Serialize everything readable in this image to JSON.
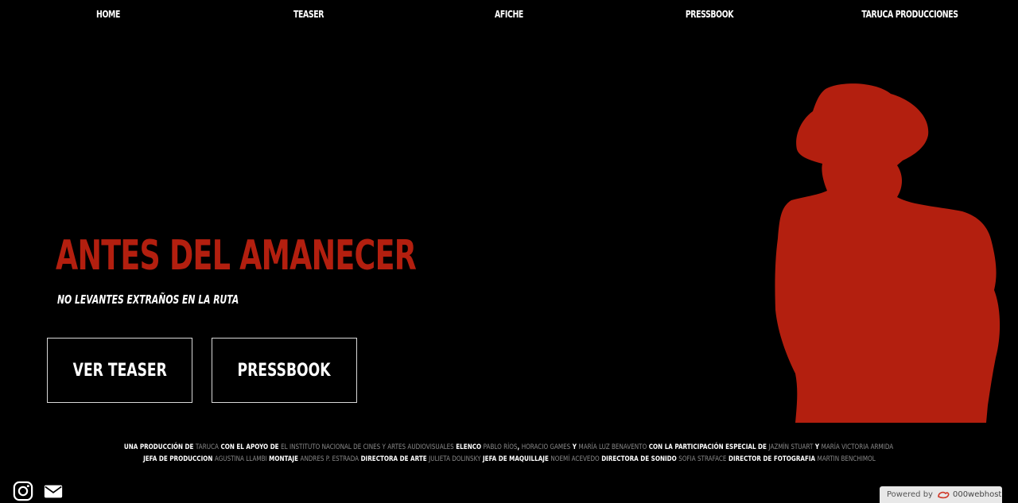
{
  "nav": {
    "items": [
      {
        "label": "HOME"
      },
      {
        "label": "TEASER"
      },
      {
        "label": "AFICHE"
      },
      {
        "label": "PRESSBOOK"
      },
      {
        "label": "TARUCA PRODUCCIONES"
      }
    ]
  },
  "hero": {
    "title": "ANTES DEL AMANECER",
    "tagline": "NO LEVANTES EXTRAÑOS EN LA RUTA",
    "buttons": {
      "teaser": "VER TEASER",
      "pressbook": "PRESSBOOK"
    }
  },
  "credits": {
    "line1": [
      {
        "t": "UNA PRODUCCIÓN DE ",
        "c": "w"
      },
      {
        "t": "TARUCA",
        "c": "g"
      },
      {
        "t": " CON EL APOYO DE ",
        "c": "w"
      },
      {
        "t": "EL INSTITUTO NACIONAL DE CINES Y ARTES AUDIOVISUALES",
        "c": "g"
      },
      {
        "t": " ELENCO ",
        "c": "w"
      },
      {
        "t": "PABLO RÍOS",
        "c": "g"
      },
      {
        "t": ", ",
        "c": "w"
      },
      {
        "t": "HORACIO GAMES",
        "c": "g"
      },
      {
        "t": " Y ",
        "c": "w"
      },
      {
        "t": "MARÍA LUZ BENAVENTO",
        "c": "g"
      },
      {
        "t": " CON LA PARTICIPACIÓN ESPECIAL DE ",
        "c": "w"
      },
      {
        "t": "JAZMÍN STUART",
        "c": "g"
      },
      {
        "t": " Y ",
        "c": "w"
      },
      {
        "t": "MARÍA VICTORIA ARMIDA",
        "c": "g"
      }
    ],
    "line2": [
      {
        "t": "JEFA DE PRODUCCION ",
        "c": "w"
      },
      {
        "t": "AGUSTINA LLAMBI",
        "c": "g"
      },
      {
        "t": " MONTAJE ",
        "c": "w"
      },
      {
        "t": "ANDRES P. ESTRADA",
        "c": "g"
      },
      {
        "t": " DIRECTORA DE ARTE ",
        "c": "w"
      },
      {
        "t": "JULIETA DOLINSKY",
        "c": "g"
      },
      {
        "t": " JEFA DE MAQUILLAJE ",
        "c": "w"
      },
      {
        "t": "NOEMÍ ACEVEDO",
        "c": "g"
      },
      {
        "t": " DIRECTORA DE SONIDO ",
        "c": "w"
      },
      {
        "t": "SOFIA STRAFACE",
        "c": "g"
      },
      {
        "t": " DIRECTOR DE FOTOGRAFIA ",
        "c": "w"
      },
      {
        "t": "MARTIN BENCHIMOL",
        "c": "g"
      }
    ]
  },
  "social": {
    "icons": [
      "instagram-icon",
      "mail-icon"
    ]
  },
  "powered": {
    "prefix": "Powered by",
    "brand": "000webhost"
  },
  "colors": {
    "background": "#000000",
    "accent": "#b31f0f"
  }
}
